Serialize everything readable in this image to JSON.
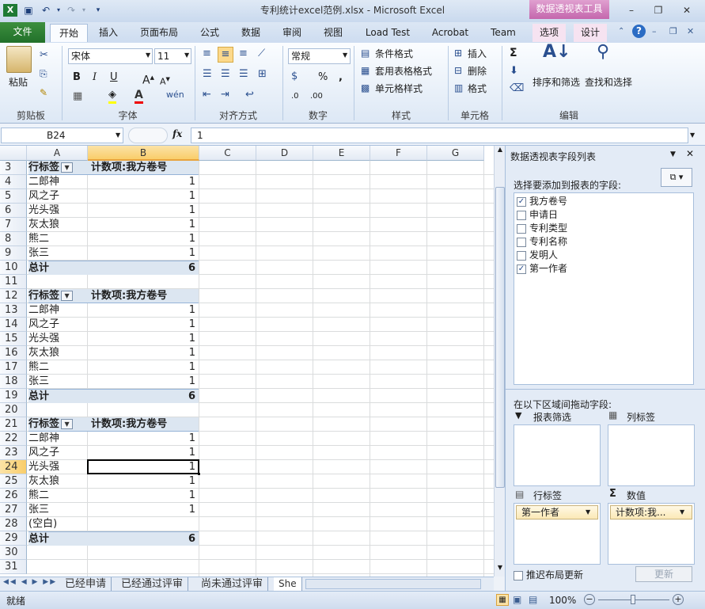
{
  "window": {
    "title": "专利统计excel范例.xlsx - Microsoft Excel",
    "context_tab": "数据透视表工具"
  },
  "tabs": [
    {
      "label": "文件"
    },
    {
      "label": "开始"
    },
    {
      "label": "插入"
    },
    {
      "label": "页面布局"
    },
    {
      "label": "公式"
    },
    {
      "label": "数据"
    },
    {
      "label": "审阅"
    },
    {
      "label": "视图"
    },
    {
      "label": "Load Test"
    },
    {
      "label": "Acrobat"
    },
    {
      "label": "Team"
    },
    {
      "label": "选项"
    },
    {
      "label": "设计"
    }
  ],
  "ribbon": {
    "paste": "粘贴",
    "clipboard": "剪贴板",
    "font_name": "宋体",
    "font_size": "11",
    "font_group": "字体",
    "align_group": "对齐方式",
    "number_format": "常规",
    "number_group": "数字",
    "cond_format": "条件格式",
    "table_format": "套用表格格式",
    "cell_style": "单元格样式",
    "styles_group": "样式",
    "insert": "插入",
    "delete": "删除",
    "format": "格式",
    "cells_group": "单元格",
    "sort_filter": "排序和筛选",
    "find_select": "查找和选择",
    "edit_group": "编辑"
  },
  "formula_bar": {
    "name_box": "B24",
    "fx": "fx",
    "value": "1"
  },
  "columns": [
    "A",
    "B",
    "C",
    "D",
    "E",
    "F",
    "G"
  ],
  "rows": [
    {
      "n": "3",
      "a": "行标签",
      "b": "计数项:我方卷号",
      "kind": "header"
    },
    {
      "n": "4",
      "a": "二郎神",
      "b": "1",
      "kind": "item"
    },
    {
      "n": "5",
      "a": "风之子",
      "b": "1",
      "kind": "item"
    },
    {
      "n": "6",
      "a": "光头强",
      "b": "1",
      "kind": "item"
    },
    {
      "n": "7",
      "a": "灰太狼",
      "b": "1",
      "kind": "item"
    },
    {
      "n": "8",
      "a": "熊二",
      "b": "1",
      "kind": "item"
    },
    {
      "n": "9",
      "a": "张三",
      "b": "1",
      "kind": "item"
    },
    {
      "n": "10",
      "a": "总计",
      "b": "6",
      "kind": "total"
    },
    {
      "n": "11",
      "a": "",
      "b": "",
      "kind": "blank"
    },
    {
      "n": "12",
      "a": "行标签",
      "b": "计数项:我方卷号",
      "kind": "header"
    },
    {
      "n": "13",
      "a": "二郎神",
      "b": "1",
      "kind": "item"
    },
    {
      "n": "14",
      "a": "风之子",
      "b": "1",
      "kind": "item"
    },
    {
      "n": "15",
      "a": "光头强",
      "b": "1",
      "kind": "item"
    },
    {
      "n": "16",
      "a": "灰太狼",
      "b": "1",
      "kind": "item"
    },
    {
      "n": "17",
      "a": "熊二",
      "b": "1",
      "kind": "item"
    },
    {
      "n": "18",
      "a": "张三",
      "b": "1",
      "kind": "item"
    },
    {
      "n": "19",
      "a": "总计",
      "b": "6",
      "kind": "total"
    },
    {
      "n": "20",
      "a": "",
      "b": "",
      "kind": "blank"
    },
    {
      "n": "21",
      "a": "行标签",
      "b": "计数项:我方卷号",
      "kind": "header"
    },
    {
      "n": "22",
      "a": "二郎神",
      "b": "1",
      "kind": "item"
    },
    {
      "n": "23",
      "a": "风之子",
      "b": "1",
      "kind": "item"
    },
    {
      "n": "24",
      "a": "光头强",
      "b": "1",
      "kind": "item"
    },
    {
      "n": "25",
      "a": "灰太狼",
      "b": "1",
      "kind": "item"
    },
    {
      "n": "26",
      "a": "熊二",
      "b": "1",
      "kind": "item"
    },
    {
      "n": "27",
      "a": "张三",
      "b": "1",
      "kind": "item"
    },
    {
      "n": "28",
      "a": "(空白)",
      "b": "",
      "kind": "item"
    },
    {
      "n": "29",
      "a": "总计",
      "b": "6",
      "kind": "total"
    },
    {
      "n": "30",
      "a": "",
      "b": "",
      "kind": "blank"
    },
    {
      "n": "31",
      "a": "",
      "b": "",
      "kind": "blank"
    }
  ],
  "selected_cell": {
    "row": "24",
    "col": "B"
  },
  "sheets": [
    "已经申请",
    "已经通过评审",
    "尚未通过评审",
    "She"
  ],
  "status": {
    "ready": "就绪",
    "zoom": "100%"
  },
  "pivot_pane": {
    "title": "数据透视表字段列表",
    "choose_label": "选择要添加到报表的字段:",
    "fields": [
      {
        "label": "我方卷号",
        "checked": "✓"
      },
      {
        "label": "申请日",
        "checked": ""
      },
      {
        "label": "专利类型",
        "checked": ""
      },
      {
        "label": "专利名称",
        "checked": ""
      },
      {
        "label": "发明人",
        "checked": ""
      },
      {
        "label": "第一作者",
        "checked": "✓"
      }
    ],
    "drag_label": "在以下区域间拖动字段:",
    "report_filter": "报表筛选",
    "col_labels": "列标签",
    "row_labels": "行标签",
    "values": "数值",
    "row_chip": "第一作者",
    "value_chip": "计数项:我...",
    "defer": "推迟布局更新",
    "update": "更新"
  }
}
